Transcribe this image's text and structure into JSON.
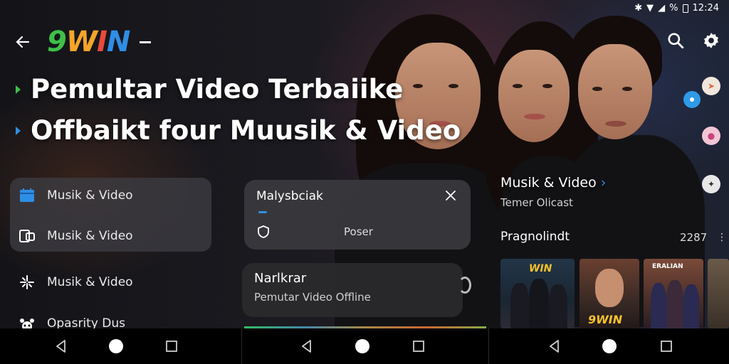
{
  "status": {
    "clock": "12:24",
    "battery": "%"
  },
  "app": {
    "logo_text": "9WIN",
    "back_icon": "arrow-left-icon"
  },
  "headlines": [
    "Pemultar Video Terbaiike",
    "Offbaikt four Muusik & Video"
  ],
  "menu": {
    "items": [
      {
        "label": "Musik & Video",
        "icon": "calendar-icon"
      },
      {
        "label": "Musik & Video",
        "icon": "share-screen-icon"
      },
      {
        "label": "Musik & Video",
        "icon": "sparkle-icon"
      },
      {
        "label": "Opasrity Dus",
        "icon": "pet-icon"
      }
    ]
  },
  "panel1": {
    "title": "Malysbciak",
    "row_label": "Poser"
  },
  "panel2": {
    "title": "Narlkrar",
    "subtitle": "Pemutar Video Offline"
  },
  "right": {
    "title": "Musik & Video",
    "subtitle": "Temer Olicast",
    "section": "Pragnolindt",
    "count": "2287"
  },
  "thumbs": [
    {
      "caption": "WIN",
      "color": "#f6c22b"
    },
    {
      "caption": "9WIN",
      "color": "#f6c22b"
    },
    {
      "caption": "ERALIAN",
      "color": "#ffffff"
    }
  ],
  "colors": {
    "accent_green": "#3fbf4a",
    "accent_blue": "#2f8ee6",
    "accent_orange": "#f4a52a",
    "accent_red": "#e84a3a"
  }
}
